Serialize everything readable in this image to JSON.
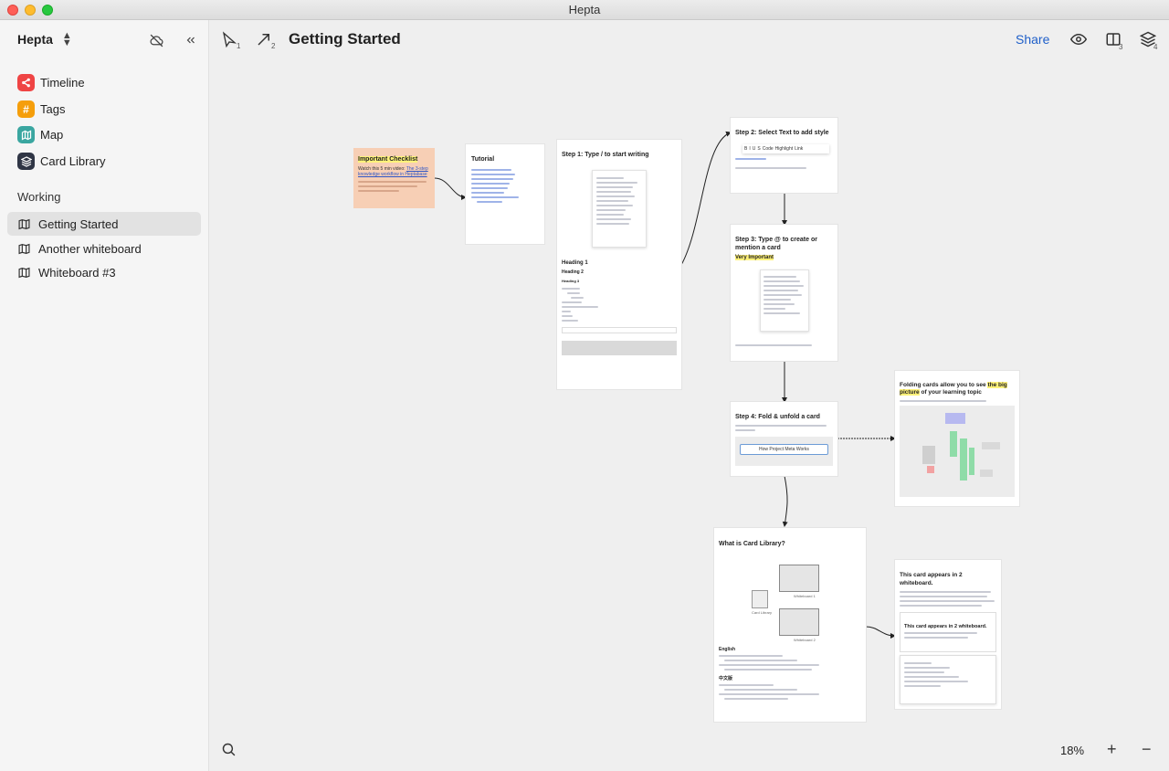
{
  "window": {
    "title": "Hepta"
  },
  "sidebar": {
    "workspace": "Hepta",
    "nav": [
      {
        "label": "Timeline",
        "icon": "timeline-icon",
        "color": "#ef4444"
      },
      {
        "label": "Tags",
        "icon": "hash-icon",
        "color": "#f59e0b"
      },
      {
        "label": "Map",
        "icon": "map-icon",
        "color": "#3aa6a0"
      },
      {
        "label": "Card Library",
        "icon": "layers-icon",
        "color": "#2f3545"
      }
    ],
    "section_label": "Working",
    "whiteboards": [
      {
        "label": "Getting Started",
        "active": true
      },
      {
        "label": "Another whiteboard",
        "active": false
      },
      {
        "label": "Whiteboard #3",
        "active": false
      }
    ]
  },
  "toolbar": {
    "select_tool_shortcut": "1",
    "arrow_tool_shortcut": "2",
    "title": "Getting Started",
    "share_label": "Share",
    "split_shortcut": "3",
    "layers_shortcut": "4"
  },
  "canvas": {
    "cards": {
      "checklist": {
        "title": "Important Checklist",
        "body": "Watch this 5 min video:",
        "link": "The 3-step knowledge workflow in Heptabase"
      },
      "tutorial": {
        "title": "Tutorial"
      },
      "step1": {
        "title": "Step 1: Type / to start writing",
        "h1": "Heading 1",
        "h2": "Heading 2",
        "h3": "Heading 3"
      },
      "step2": {
        "title": "Step 2: Select Text to add style",
        "format_buttons": [
          "B",
          "I",
          "U",
          "S",
          "Code",
          "Highlight",
          "Link"
        ]
      },
      "step3": {
        "title": "Step 3: Type @ to create or mention a card",
        "highlight": "Very Important"
      },
      "step4": {
        "title": "Step 4: Fold & unfold a card",
        "folded_card": "How Project Meta Works"
      },
      "folding": {
        "title_prefix": "Folding cards allow you to see ",
        "title_highlight": "the big picture",
        "title_suffix": " of your learning topic"
      },
      "card_library": {
        "title": "What is Card Library?",
        "section_en": "English",
        "section_zh": "中文版",
        "label_library": "Card Library",
        "label_wb1": "Whiteboard 1",
        "label_wb2": "Whiteboard 2"
      },
      "two_whiteboards": {
        "title": "This card appears in 2 whiteboard.",
        "inner_title": "This card appears in 2 whiteboard."
      }
    }
  },
  "bottom": {
    "zoom": "18%",
    "zoom_in": "+",
    "zoom_out": "−"
  }
}
